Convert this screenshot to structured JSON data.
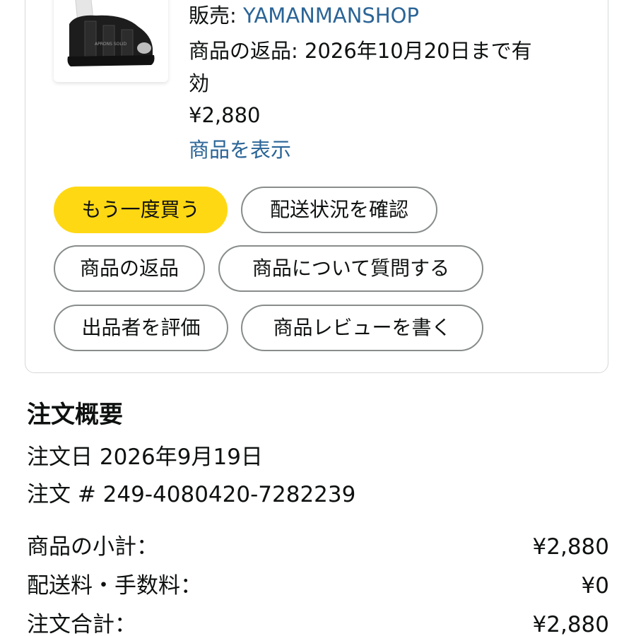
{
  "item": {
    "seller_label": "販売: ",
    "seller_name": "YAMANMANSHOP",
    "return_line1": "商品の返品: 2026年10月20日まで有",
    "return_line2": "効",
    "price": "¥2,880",
    "view_item_link": "商品を表示",
    "shoe_brand_text": "APRONS SOLID"
  },
  "actions": {
    "buy_again": "もう一度買う",
    "track_package": "配送状況を確認",
    "return_item": "商品の返品",
    "ask_question": "商品について質問する",
    "rate_seller": "出品者を評価",
    "write_review": "商品レビューを書く"
  },
  "summary": {
    "title": "注文概要",
    "order_date": "注文日 2026年9月19日",
    "order_number": "注文 # 249-4080420-7282239",
    "rows": [
      {
        "label": "商品の小計：",
        "value": "¥2,880"
      },
      {
        "label": "配送料・手数料：",
        "value": "¥0"
      },
      {
        "label": "注文合計：",
        "value": "¥2,880"
      }
    ]
  },
  "colors": {
    "primary_button": "#ffd814",
    "link": "#2a6496",
    "border": "#888c8c"
  }
}
